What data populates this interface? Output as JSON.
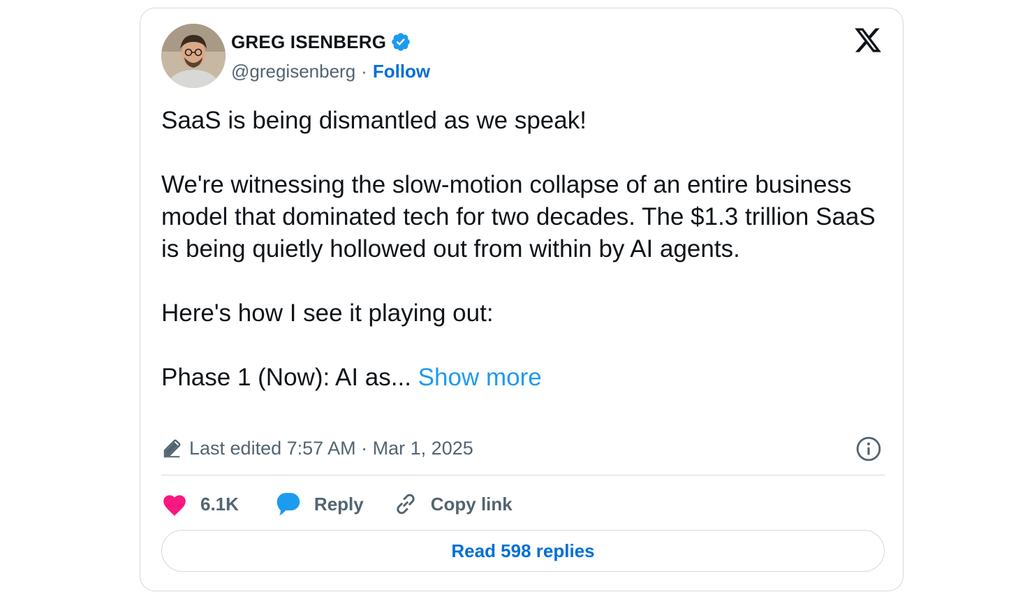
{
  "author": {
    "name": "GREG ISENBERG",
    "handle": "@gregisenberg",
    "separator": "·",
    "follow_label": "Follow",
    "verified_color": "#1d9bf0"
  },
  "tweet": {
    "paragraphs": [
      "SaaS is being dismantled as we speak!",
      "We're witnessing the slow-motion collapse of an entire business model that dominated tech for two decades. The $1.3 trillion SaaS is being quietly hollowed out from within by AI agents.",
      "Here's how I see it playing out:"
    ],
    "truncated_line": "Phase 1 (Now): AI as...",
    "show_more_label": "Show more"
  },
  "meta": {
    "edited_text": "Last edited 7:57 AM · Mar 1, 2025"
  },
  "actions": {
    "like_count": "6.1K",
    "reply_label": "Reply",
    "copy_link_label": "Copy link"
  },
  "footer": {
    "read_replies_label": "Read 598 replies"
  },
  "colors": {
    "link_blue": "#1d9bf0",
    "follow_blue": "#006fd6",
    "like_pink": "#f91880",
    "secondary_text": "#536471",
    "border": "#cfd9de"
  },
  "icons": {
    "verified": "verified-badge-icon",
    "logo": "x-logo-icon",
    "edited": "pencil-icon",
    "info": "info-icon",
    "like": "heart-icon",
    "reply": "speech-bubble-icon",
    "copy_link": "link-icon"
  }
}
